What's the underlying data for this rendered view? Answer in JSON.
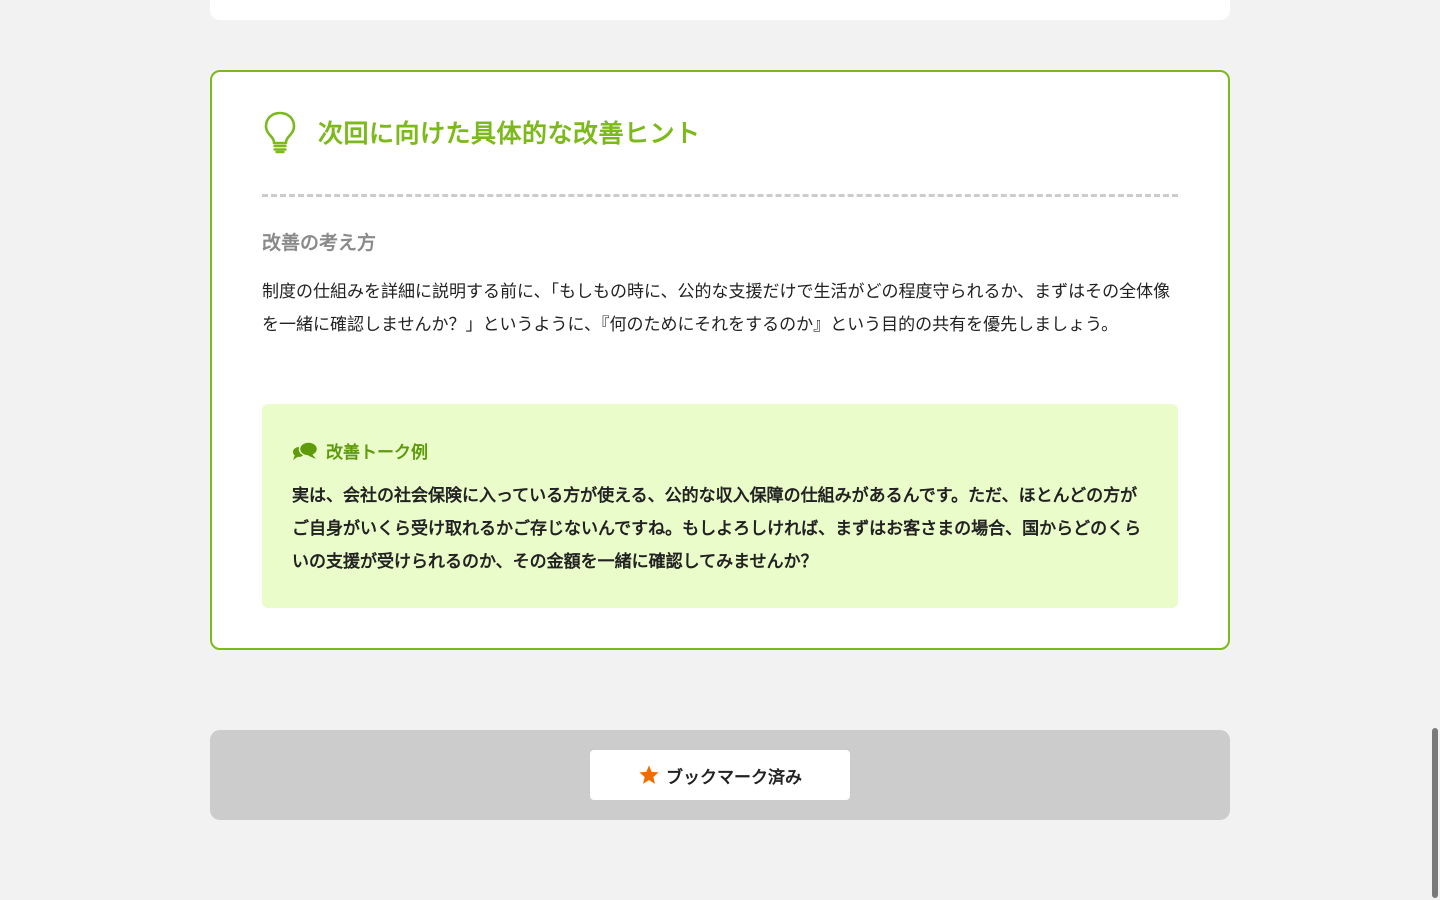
{
  "hint_card": {
    "title": "次回に向けた具体的な改善ヒント",
    "icon": "lightbulb-icon",
    "section_heading": "改善の考え方",
    "body": "制度の仕組みを詳細に説明する前に、「もしもの時に、公的な支援だけで生活がどの程度守られるか、まずはその全体像を一緒に確認しませんか？」というように、『何のためにそれをするのか』という目的の共有を優先しましょう。",
    "talk_example": {
      "icon": "speech-bubbles-icon",
      "label": "改善トーク例",
      "text": "実は、会社の社会保険に入っている方が使える、公的な収入保障の仕組みがあるんです。ただ、ほとんどの方がご自身がいくら受け取れるかご存じないんですね。もしよろしければ、まずはお客さまの場合、国からどのくらいの支援が受けられるのか、その金額を一緒に確認してみませんか？"
    }
  },
  "bookmark": {
    "icon": "star-icon",
    "label": "ブックマーク済み"
  },
  "colors": {
    "accent_green": "#7cb91a",
    "talk_label_green": "#5d9a0c",
    "talk_bg": "#ebfccb",
    "star_orange": "#ef6c00",
    "page_bg": "#f2f2f2",
    "bookmark_bar_bg": "#cccccc"
  }
}
